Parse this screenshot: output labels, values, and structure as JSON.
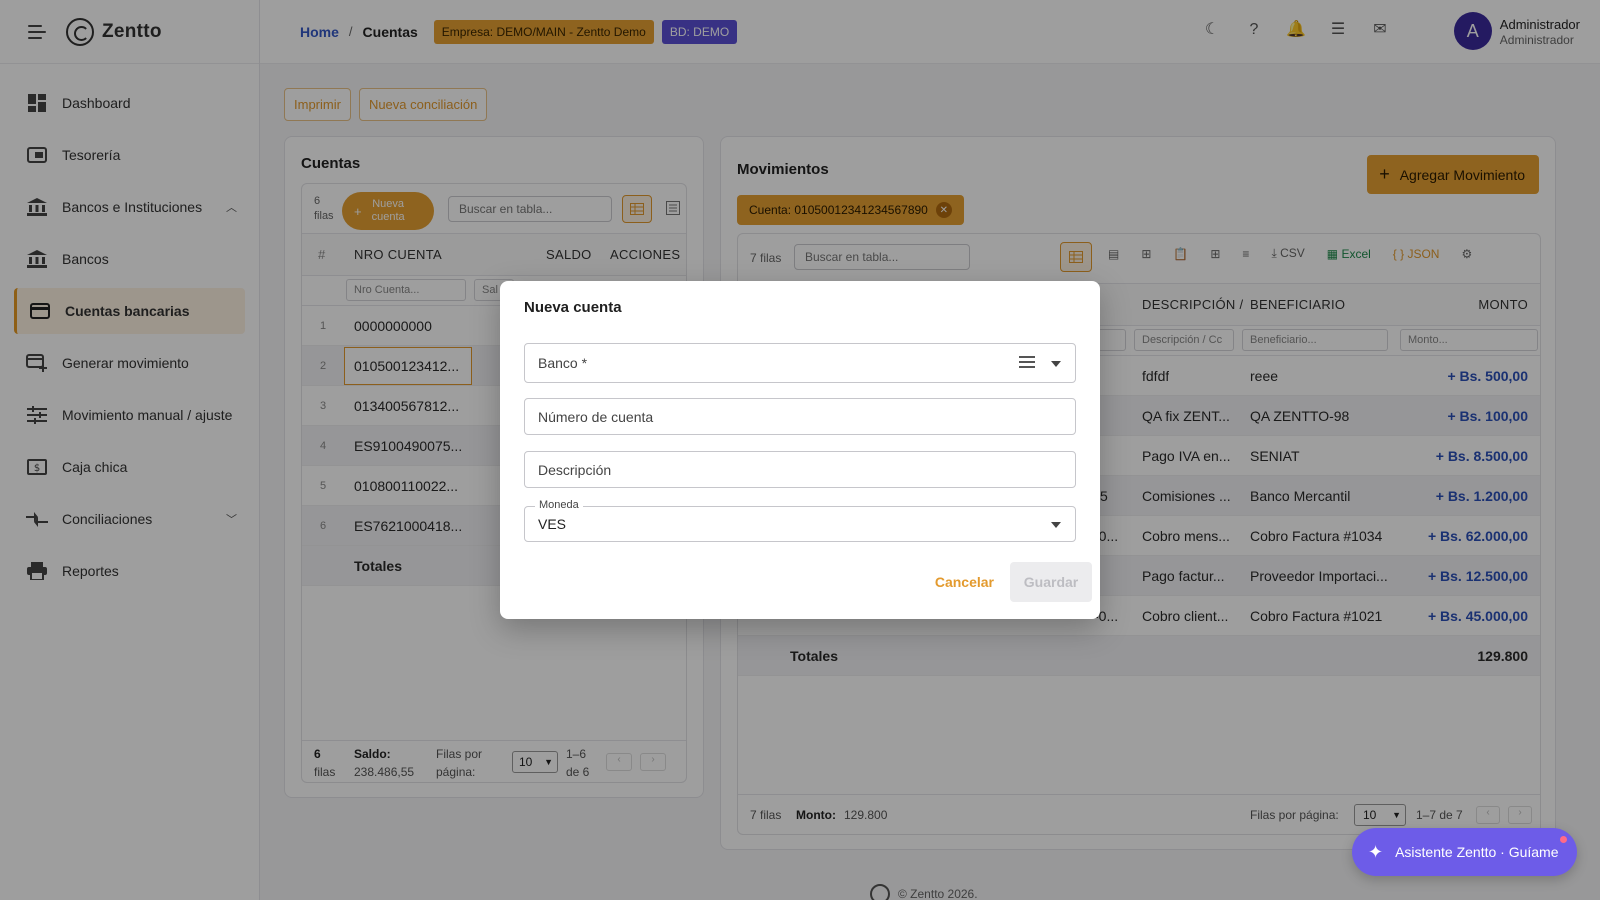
{
  "brand": {
    "name": "Zentto"
  },
  "sidebar": {
    "items": [
      {
        "label": "Dashboard",
        "icon": "dashboard-icon"
      },
      {
        "label": "Tesorería",
        "icon": "treasury-icon"
      },
      {
        "label": "Bancos e Instituciones",
        "icon": "bank-icon"
      },
      {
        "label": "Bancos",
        "icon": "bank-icon"
      },
      {
        "label": "Cuentas bancarias",
        "icon": "card-icon"
      },
      {
        "label": "Generar movimiento",
        "icon": "add-card-icon"
      },
      {
        "label": "Movimiento manual / ajuste",
        "icon": "tune-icon"
      },
      {
        "label": "Caja chica",
        "icon": "cash-icon"
      },
      {
        "label": "Conciliaciones",
        "icon": "compare-icon"
      },
      {
        "label": "Reportes",
        "icon": "print-icon"
      }
    ]
  },
  "header": {
    "breadcrumb_home": "Home",
    "breadcrumb_sep": "/",
    "breadcrumb_current": "Cuentas",
    "chip_empresa": "Empresa: DEMO/MAIN - Zentto Demo",
    "chip_bd": "BD: DEMO",
    "user_initial": "A",
    "user_name": "Administrador",
    "user_role": "Administrador"
  },
  "actions": {
    "print": "Imprimir",
    "nueva_conciliacion": "Nueva conciliación"
  },
  "cuentas": {
    "title": "Cuentas",
    "rows_count": "6",
    "rows_word": "filas",
    "new_plus": "+",
    "new_label_1": "Nueva",
    "new_label_2": "cuenta",
    "search_placeholder": "Buscar en tabla...",
    "col_num": "#",
    "col_nro": "NRO CUENTA",
    "col_saldo": "SALDO",
    "col_acciones": "ACCIONES",
    "filter_nro": "Nro Cuenta...",
    "filter_saldo": "Sal",
    "rows": [
      {
        "n": "1",
        "nro": "0000000000"
      },
      {
        "n": "2",
        "nro": "010500123412..."
      },
      {
        "n": "3",
        "nro": "013400567812..."
      },
      {
        "n": "4",
        "nro": "ES9100490075..."
      },
      {
        "n": "5",
        "nro": "010800110022..."
      },
      {
        "n": "6",
        "nro": "ES7621000418..."
      }
    ],
    "totals": "Totales",
    "footer_count": "6",
    "footer_filas": "filas",
    "footer_saldo_label": "Saldo:",
    "footer_saldo_value": "238.486,55",
    "footer_rows_per_page_1": "Filas por",
    "footer_rows_per_page_2": "página:",
    "footer_page_size": "10",
    "footer_range_1": "1–6",
    "footer_range_2": "de 6"
  },
  "movimientos": {
    "title": "Movimientos",
    "agregar": "Agregar Movimiento",
    "cuenta_chip": "Cuenta: 01050012341234567890",
    "rows_label": "7 filas",
    "search_placeholder": "Buscar en tabla...",
    "csv": "CSV",
    "excel": "Excel",
    "json": "JSON",
    "col_desc": "DESCRIPCIÓN /",
    "col_benef": "BENEFICIARIO",
    "col_monto": "MONTO",
    "filter_desc": "Descripción / Cc",
    "filter_benef": "Beneficiario...",
    "filter_monto": "Monto...",
    "rows": [
      {
        "left": "",
        "desc": "fdfdf",
        "benef": "reee",
        "monto": "+ Bs. 500,00"
      },
      {
        "left": "",
        "desc": "QA fix ZENT...",
        "benef": "QA ZENTTO-98",
        "monto": "+ Bs. 100,00"
      },
      {
        "left": "",
        "desc": "Pago IVA en...",
        "benef": "SENIAT",
        "monto": "+ Bs. 8.500,00"
      },
      {
        "left": "5",
        "desc": "Comisiones ...",
        "benef": "Banco Mercantil",
        "monto": "+ Bs. 1.200,00"
      },
      {
        "left": "-0...",
        "desc": "Cobro mens...",
        "benef": "Cobro Factura #1034",
        "monto": "+ Bs. 62.000,00"
      },
      {
        "left": "",
        "desc": "Pago factur...",
        "benef": "Proveedor Importaci...",
        "monto": "+ Bs. 12.500,00"
      },
      {
        "left": "-0...",
        "desc": "Cobro client...",
        "benef": "Cobro Factura #1021",
        "monto": "+ Bs. 45.000,00"
      }
    ],
    "totals": "Totales",
    "totals_value": "129.800",
    "footer_filas": "7 filas",
    "footer_monto_label": "Monto:",
    "footer_monto_value": "129.800",
    "footer_rows_per_page": "Filas por página:",
    "footer_page_size": "10",
    "footer_range": "1–7 de 7"
  },
  "modal": {
    "title": "Nueva cuenta",
    "banco_label": "Banco *",
    "numero_placeholder": "Número de cuenta",
    "descripcion_placeholder": "Descripción",
    "moneda_label": "Moneda",
    "moneda_value": "VES",
    "cancel": "Cancelar",
    "save": "Guardar"
  },
  "assistant": {
    "label": "Asistente Zentto · Guíame"
  },
  "footer": {
    "copyright": "© Zentto 2026."
  },
  "colors": {
    "accent": "#e5a032",
    "primary": "#5b4fd6",
    "link": "#3557c6"
  }
}
